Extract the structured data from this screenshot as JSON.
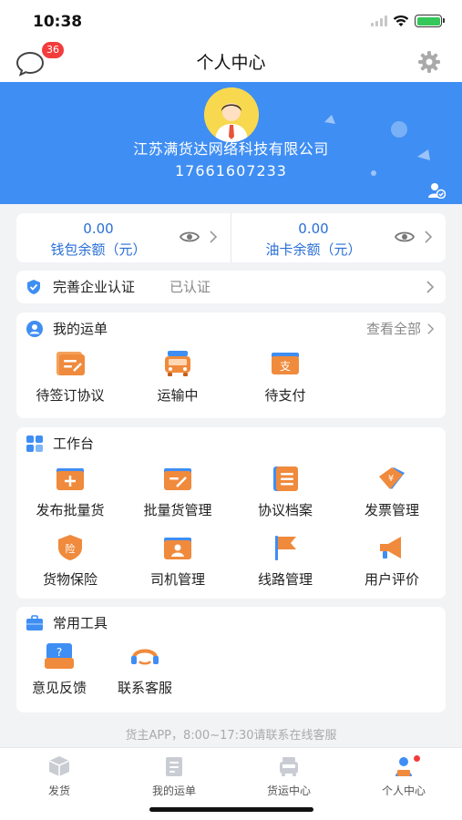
{
  "status_bar": {
    "time": "10:38"
  },
  "nav": {
    "title": "个人中心",
    "message_badge": "36"
  },
  "profile": {
    "company": "江苏满货达网络科技有限公司",
    "phone": "17661607233"
  },
  "balances": [
    {
      "amount": "0.00",
      "label": "钱包余额（元）"
    },
    {
      "amount": "0.00",
      "label": "油卡余额（元）"
    }
  ],
  "auth": {
    "title": "完善企业认证",
    "status": "已认证"
  },
  "orders": {
    "title": "我的运单",
    "view_all": "查看全部",
    "items": [
      {
        "label": "待签订协议",
        "icon": "contract-icon"
      },
      {
        "label": "运输中",
        "icon": "truck-icon"
      },
      {
        "label": "待支付",
        "icon": "payment-icon"
      }
    ]
  },
  "workbench": {
    "title": "工作台",
    "items": [
      {
        "label": "发布批量货",
        "icon": "publish-cargo-icon"
      },
      {
        "label": "批量货管理",
        "icon": "cargo-manage-icon"
      },
      {
        "label": "协议档案",
        "icon": "agreement-archive-icon"
      },
      {
        "label": "发票管理",
        "icon": "invoice-icon"
      },
      {
        "label": "货物保险",
        "icon": "insurance-icon"
      },
      {
        "label": "司机管理",
        "icon": "driver-icon"
      },
      {
        "label": "线路管理",
        "icon": "route-flag-icon"
      },
      {
        "label": "用户评价",
        "icon": "megaphone-icon"
      }
    ]
  },
  "tools": {
    "title": "常用工具",
    "items": [
      {
        "label": "意见反馈",
        "icon": "feedback-icon"
      },
      {
        "label": "联系客服",
        "icon": "customer-service-icon"
      }
    ]
  },
  "service_tip": "货主APP，8:00~17:30请联系在线客服",
  "tabs": [
    {
      "label": "发货",
      "icon": "box-icon"
    },
    {
      "label": "我的运单",
      "icon": "waybill-icon"
    },
    {
      "label": "货运中心",
      "icon": "freight-center-icon"
    },
    {
      "label": "个人中心",
      "icon": "profile-icon",
      "active": true
    }
  ],
  "colors": {
    "primary": "#3f8ef3",
    "accent_orange": "#f08a3c",
    "badge_red": "#f23c3c",
    "link_blue": "#2a6fd6"
  }
}
